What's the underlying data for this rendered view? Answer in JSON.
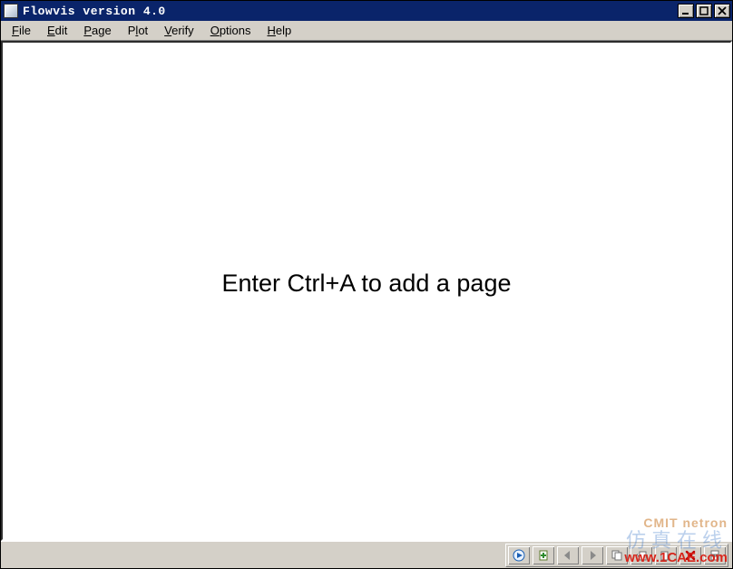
{
  "window": {
    "title": "Flowvis version 4.0"
  },
  "menu": {
    "items": [
      {
        "label": "File",
        "accel_index": 0
      },
      {
        "label": "Edit",
        "accel_index": 0
      },
      {
        "label": "Page",
        "accel_index": 0
      },
      {
        "label": "Plot",
        "accel_index": 1
      },
      {
        "label": "Verify",
        "accel_index": 0
      },
      {
        "label": "Options",
        "accel_index": 0
      },
      {
        "label": "Help",
        "accel_index": 0
      }
    ]
  },
  "content": {
    "hint": "Enter Ctrl+A to add a page"
  },
  "toolbar": {
    "icons": [
      "play-icon",
      "add-page-icon",
      "back-icon",
      "forward-icon",
      "copy-icon",
      "clone-left-icon",
      "clone-right-icon",
      "delete-icon",
      "page-break-icon"
    ]
  },
  "watermark": {
    "line1": "仿真在线",
    "line2": "www.1CAE.com",
    "logo": "CMIT netron"
  }
}
